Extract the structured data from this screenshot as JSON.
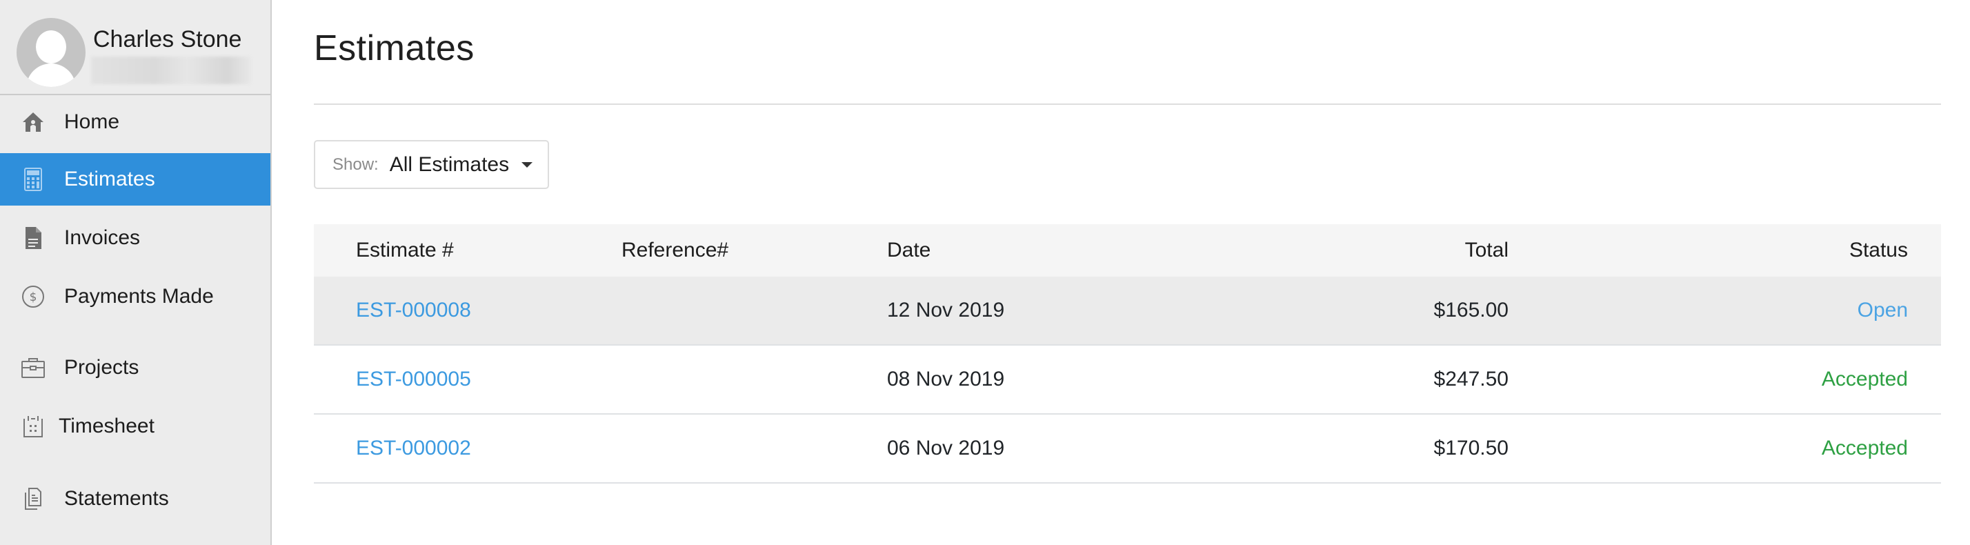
{
  "user": {
    "name": "Charles Stone",
    "avatar_icon": "user-silhouette-icon"
  },
  "sidebar": {
    "items": [
      {
        "label": "Home",
        "icon": "home-icon",
        "active": false
      },
      {
        "label": "Estimates",
        "icon": "calculator-icon",
        "active": true
      },
      {
        "label": "Invoices",
        "icon": "document-icon",
        "active": false
      },
      {
        "label": "Payments Made",
        "icon": "dollar-circle-icon",
        "active": false
      },
      {
        "label": "Projects",
        "icon": "briefcase-icon",
        "active": false
      },
      {
        "label": "Timesheet",
        "icon": "calendar-icon",
        "active": false
      },
      {
        "label": "Statements",
        "icon": "statements-icon",
        "active": false
      }
    ],
    "active_color": "#2f8fdb"
  },
  "main": {
    "title": "Estimates",
    "filter": {
      "label": "Show:",
      "value": "All Estimates"
    },
    "table": {
      "columns": [
        "Estimate #",
        "Reference#",
        "Date",
        "Total",
        "Status"
      ],
      "rows": [
        {
          "estimate": "EST-000008",
          "reference": "",
          "date": "12 Nov 2019",
          "total": "$165.00",
          "status": "Open"
        },
        {
          "estimate": "EST-000005",
          "reference": "",
          "date": "08 Nov 2019",
          "total": "$247.50",
          "status": "Accepted"
        },
        {
          "estimate": "EST-000002",
          "reference": "",
          "date": "06 Nov 2019",
          "total": "$170.50",
          "status": "Accepted"
        }
      ]
    },
    "colors": {
      "link": "#3c9ae0",
      "status_open": "#4ba3e3",
      "status_accepted": "#2ea043"
    }
  }
}
